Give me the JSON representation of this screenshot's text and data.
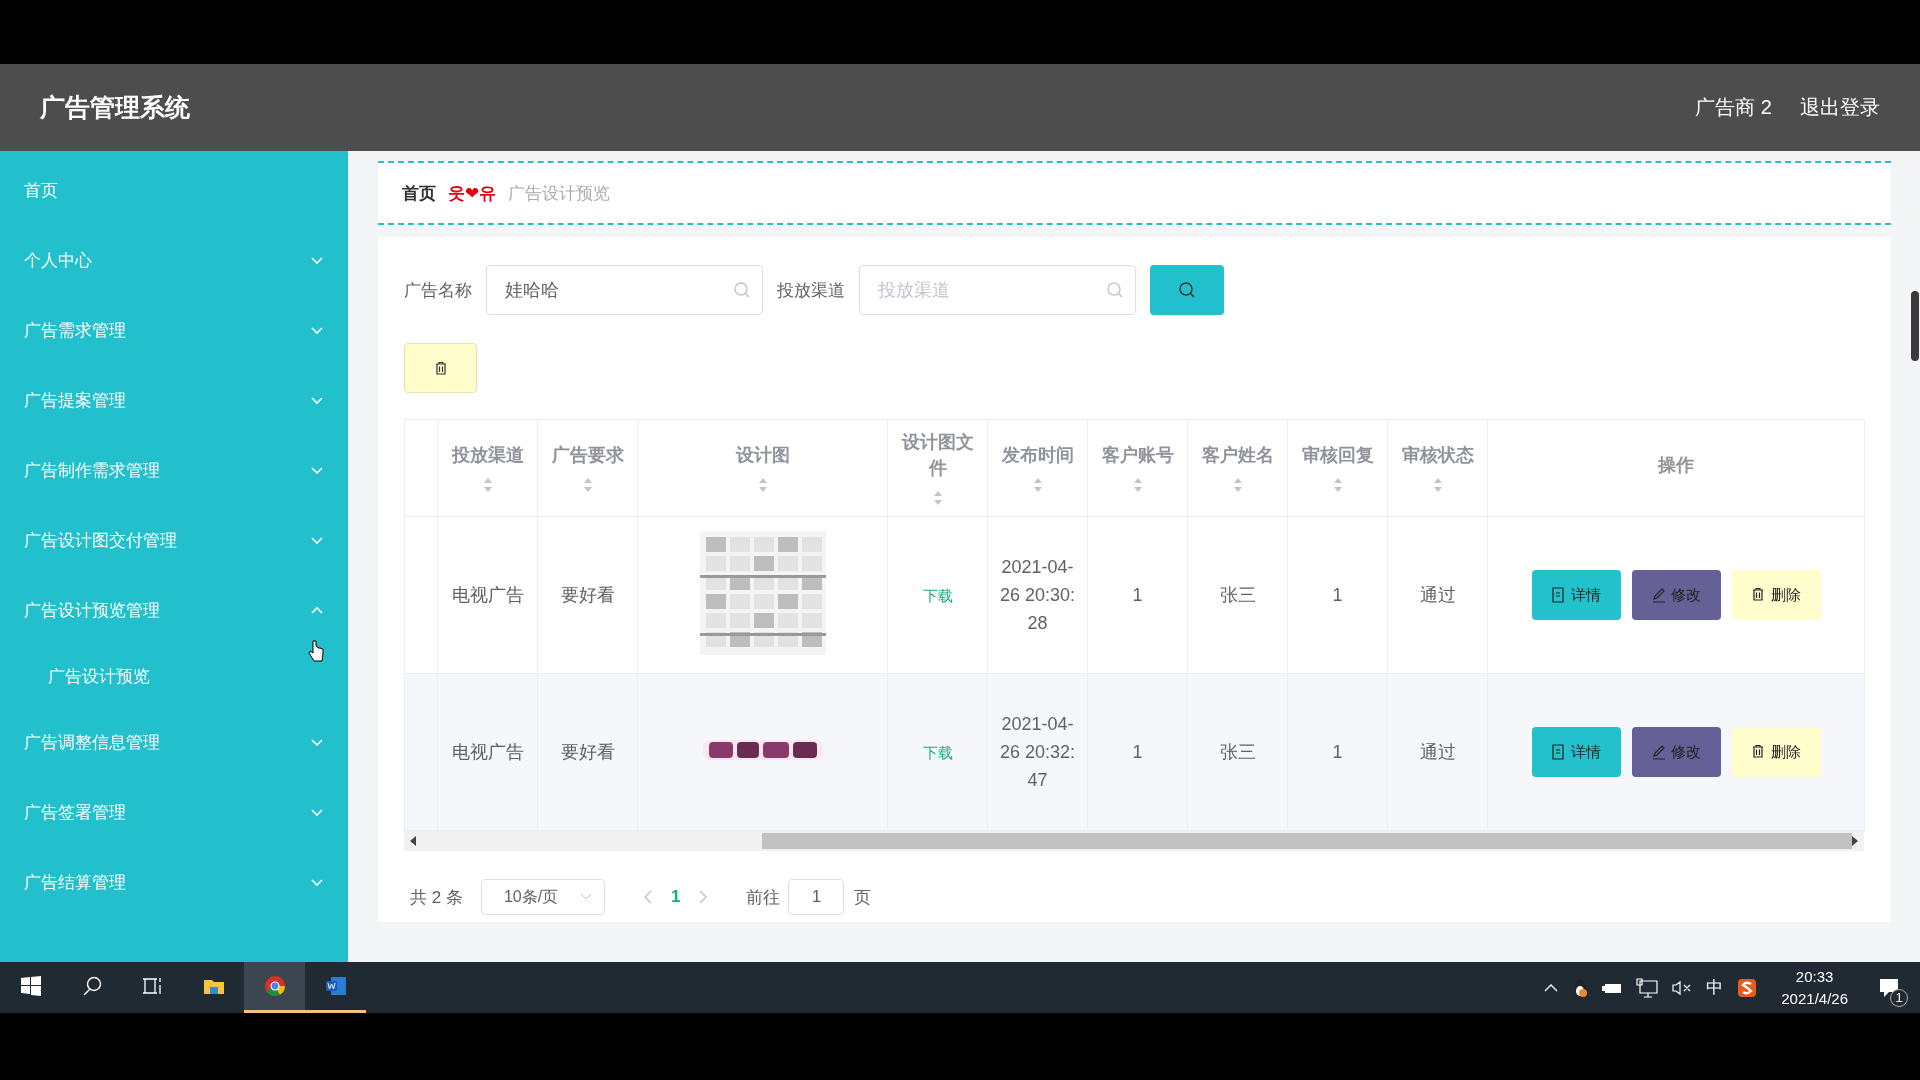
{
  "header": {
    "title": "广告管理系统",
    "user": "广告商 2",
    "logout": "退出登录"
  },
  "sidebar": {
    "items": [
      {
        "label": "首页"
      },
      {
        "label": "个人中心",
        "expanded": false
      },
      {
        "label": "广告需求管理",
        "expanded": false
      },
      {
        "label": "广告提案管理",
        "expanded": false
      },
      {
        "label": "广告制作需求管理",
        "expanded": false
      },
      {
        "label": "广告设计图交付管理",
        "expanded": false
      },
      {
        "label": "广告设计预览管理",
        "expanded": true,
        "children": [
          {
            "label": "广告设计预览"
          }
        ]
      },
      {
        "label": "广告调整信息管理",
        "expanded": false
      },
      {
        "label": "广告签署管理",
        "expanded": false
      },
      {
        "label": "广告结算管理",
        "expanded": false
      }
    ]
  },
  "breadcrumb": {
    "items": [
      "首页",
      "广告设计预览"
    ],
    "separator": "웃❤유"
  },
  "search": {
    "fields": [
      {
        "label": "广告名称",
        "value": "娃哈哈"
      },
      {
        "label": "投放渠道",
        "placeholder": "投放渠道"
      }
    ]
  },
  "table": {
    "columns": [
      {
        "label": "投放渠道",
        "sortable": true
      },
      {
        "label": "广告要求",
        "sortable": true
      },
      {
        "label": "设计图",
        "sortable": true
      },
      {
        "label": "设计图文件",
        "sortable": true
      },
      {
        "label": "发布时间",
        "sortable": true
      },
      {
        "label": "客户账号",
        "sortable": true
      },
      {
        "label": "客户姓名",
        "sortable": true
      },
      {
        "label": "审核回复",
        "sortable": true
      },
      {
        "label": "审核状态",
        "sortable": true
      },
      {
        "label": "操作",
        "sortable": false
      }
    ],
    "rows": [
      {
        "channel": "电视广告",
        "requirement": "要好看",
        "file": "下载",
        "time": "2021-04-26 20:30:28",
        "account": "1",
        "name": "张三",
        "reply": "1",
        "status": "通过",
        "actions": [
          {
            "kind": "detail",
            "label": "详情"
          },
          {
            "kind": "edit",
            "label": "修改"
          },
          {
            "kind": "delete",
            "label": "删除"
          }
        ]
      },
      {
        "channel": "电视广告",
        "requirement": "要好看",
        "file": "下载",
        "time": "2021-04-26 20:32:47",
        "account": "1",
        "name": "张三",
        "reply": "1",
        "status": "通过",
        "actions": [
          {
            "kind": "detail",
            "label": "详情"
          },
          {
            "kind": "edit",
            "label": "修改"
          },
          {
            "kind": "delete",
            "label": "删除"
          }
        ]
      }
    ]
  },
  "pagination": {
    "total": "共 2 条",
    "page_size": "10条/页",
    "pages": [
      {
        "label": "1",
        "selected": true
      }
    ],
    "goto_label": "前往",
    "goto_value": "1",
    "goto_suffix": "页"
  },
  "taskbar": {
    "apps": [
      {
        "kind": "start"
      },
      {
        "kind": "search"
      },
      {
        "kind": "taskview"
      },
      {
        "kind": "explorer",
        "running": false,
        "active": false
      },
      {
        "kind": "chrome",
        "running": true,
        "active": true
      },
      {
        "kind": "word",
        "running": true,
        "active": false
      }
    ],
    "ime": "中",
    "time": "20:33",
    "date": "2021/4/26",
    "notifications": "1"
  }
}
